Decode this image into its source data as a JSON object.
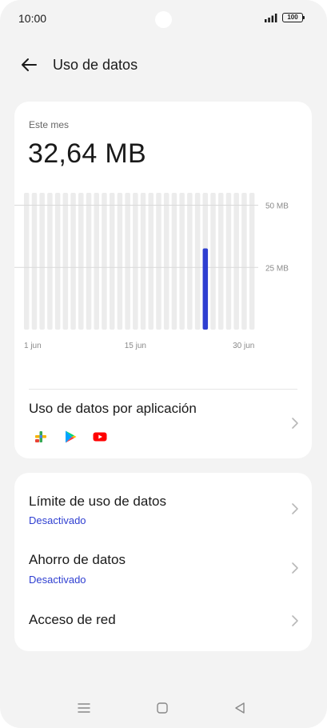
{
  "status_bar": {
    "time": "10:00",
    "battery": "100",
    "icons": [
      "camera-cutout",
      "signal-icon",
      "battery-icon"
    ]
  },
  "header": {
    "title": "Uso de datos",
    "back_icon": "arrow-left-icon"
  },
  "summary": {
    "period_label": "Este mes",
    "total": "32,64 MB",
    "chart_data": {
      "type": "bar",
      "x": [
        "1 jun",
        "2 jun",
        "3 jun",
        "4 jun",
        "5 jun",
        "6 jun",
        "7 jun",
        "8 jun",
        "9 jun",
        "10 jun",
        "11 jun",
        "12 jun",
        "13 jun",
        "14 jun",
        "15 jun",
        "16 jun",
        "17 jun",
        "18 jun",
        "19 jun",
        "20 jun",
        "21 jun",
        "22 jun",
        "23 jun",
        "24 jun",
        "25 jun",
        "26 jun",
        "27 jun",
        "28 jun",
        "29 jun",
        "30 jun"
      ],
      "values": [
        0,
        0,
        0,
        0,
        0,
        0,
        0,
        0,
        0,
        0,
        0,
        0,
        0,
        0,
        0,
        0,
        0,
        0,
        0,
        0,
        0,
        0,
        0,
        32.64,
        0,
        0,
        0,
        0,
        0,
        0
      ],
      "x_tick_labels": [
        "1 jun",
        "15 jun",
        "30 jun"
      ],
      "y_tick_labels": [
        "50 MB",
        "25 MB"
      ],
      "y_ticks": [
        50,
        25
      ],
      "ylim": [
        0,
        55
      ],
      "bar_color": "#2f3fd1",
      "track_color": "#ececec",
      "grid": true
    }
  },
  "app_usage": {
    "title": "Uso de datos por aplicación",
    "icons": [
      "multicolor-app-icon",
      "google-play-icon",
      "youtube-icon"
    ]
  },
  "settings": [
    {
      "title": "Límite de uso de datos",
      "subtitle": "Desactivado"
    },
    {
      "title": "Ahorro de datos",
      "subtitle": "Desactivado"
    },
    {
      "title": "Acceso de red",
      "subtitle": ""
    }
  ],
  "colors": {
    "accent": "#2f3fd1",
    "background": "#f3f3f3",
    "card": "#ffffff"
  },
  "nav_bar": {
    "icons": [
      "menu-icon",
      "home-icon",
      "back-icon"
    ]
  }
}
